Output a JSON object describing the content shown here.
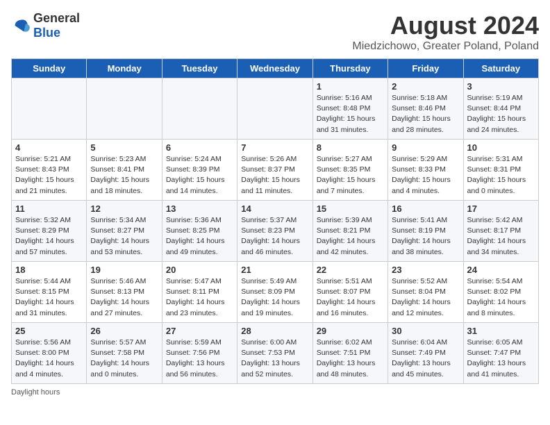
{
  "logo": {
    "general": "General",
    "blue": "Blue"
  },
  "title": "August 2024",
  "subtitle": "Miedzichowo, Greater Poland, Poland",
  "days_of_week": [
    "Sunday",
    "Monday",
    "Tuesday",
    "Wednesday",
    "Thursday",
    "Friday",
    "Saturday"
  ],
  "weeks": [
    [
      {
        "day": "",
        "info": ""
      },
      {
        "day": "",
        "info": ""
      },
      {
        "day": "",
        "info": ""
      },
      {
        "day": "",
        "info": ""
      },
      {
        "day": "1",
        "info": "Sunrise: 5:16 AM\nSunset: 8:48 PM\nDaylight: 15 hours and 31 minutes."
      },
      {
        "day": "2",
        "info": "Sunrise: 5:18 AM\nSunset: 8:46 PM\nDaylight: 15 hours and 28 minutes."
      },
      {
        "day": "3",
        "info": "Sunrise: 5:19 AM\nSunset: 8:44 PM\nDaylight: 15 hours and 24 minutes."
      }
    ],
    [
      {
        "day": "4",
        "info": "Sunrise: 5:21 AM\nSunset: 8:43 PM\nDaylight: 15 hours and 21 minutes."
      },
      {
        "day": "5",
        "info": "Sunrise: 5:23 AM\nSunset: 8:41 PM\nDaylight: 15 hours and 18 minutes."
      },
      {
        "day": "6",
        "info": "Sunrise: 5:24 AM\nSunset: 8:39 PM\nDaylight: 15 hours and 14 minutes."
      },
      {
        "day": "7",
        "info": "Sunrise: 5:26 AM\nSunset: 8:37 PM\nDaylight: 15 hours and 11 minutes."
      },
      {
        "day": "8",
        "info": "Sunrise: 5:27 AM\nSunset: 8:35 PM\nDaylight: 15 hours and 7 minutes."
      },
      {
        "day": "9",
        "info": "Sunrise: 5:29 AM\nSunset: 8:33 PM\nDaylight: 15 hours and 4 minutes."
      },
      {
        "day": "10",
        "info": "Sunrise: 5:31 AM\nSunset: 8:31 PM\nDaylight: 15 hours and 0 minutes."
      }
    ],
    [
      {
        "day": "11",
        "info": "Sunrise: 5:32 AM\nSunset: 8:29 PM\nDaylight: 14 hours and 57 minutes."
      },
      {
        "day": "12",
        "info": "Sunrise: 5:34 AM\nSunset: 8:27 PM\nDaylight: 14 hours and 53 minutes."
      },
      {
        "day": "13",
        "info": "Sunrise: 5:36 AM\nSunset: 8:25 PM\nDaylight: 14 hours and 49 minutes."
      },
      {
        "day": "14",
        "info": "Sunrise: 5:37 AM\nSunset: 8:23 PM\nDaylight: 14 hours and 46 minutes."
      },
      {
        "day": "15",
        "info": "Sunrise: 5:39 AM\nSunset: 8:21 PM\nDaylight: 14 hours and 42 minutes."
      },
      {
        "day": "16",
        "info": "Sunrise: 5:41 AM\nSunset: 8:19 PM\nDaylight: 14 hours and 38 minutes."
      },
      {
        "day": "17",
        "info": "Sunrise: 5:42 AM\nSunset: 8:17 PM\nDaylight: 14 hours and 34 minutes."
      }
    ],
    [
      {
        "day": "18",
        "info": "Sunrise: 5:44 AM\nSunset: 8:15 PM\nDaylight: 14 hours and 31 minutes."
      },
      {
        "day": "19",
        "info": "Sunrise: 5:46 AM\nSunset: 8:13 PM\nDaylight: 14 hours and 27 minutes."
      },
      {
        "day": "20",
        "info": "Sunrise: 5:47 AM\nSunset: 8:11 PM\nDaylight: 14 hours and 23 minutes."
      },
      {
        "day": "21",
        "info": "Sunrise: 5:49 AM\nSunset: 8:09 PM\nDaylight: 14 hours and 19 minutes."
      },
      {
        "day": "22",
        "info": "Sunrise: 5:51 AM\nSunset: 8:07 PM\nDaylight: 14 hours and 16 minutes."
      },
      {
        "day": "23",
        "info": "Sunrise: 5:52 AM\nSunset: 8:04 PM\nDaylight: 14 hours and 12 minutes."
      },
      {
        "day": "24",
        "info": "Sunrise: 5:54 AM\nSunset: 8:02 PM\nDaylight: 14 hours and 8 minutes."
      }
    ],
    [
      {
        "day": "25",
        "info": "Sunrise: 5:56 AM\nSunset: 8:00 PM\nDaylight: 14 hours and 4 minutes."
      },
      {
        "day": "26",
        "info": "Sunrise: 5:57 AM\nSunset: 7:58 PM\nDaylight: 14 hours and 0 minutes."
      },
      {
        "day": "27",
        "info": "Sunrise: 5:59 AM\nSunset: 7:56 PM\nDaylight: 13 hours and 56 minutes."
      },
      {
        "day": "28",
        "info": "Sunrise: 6:00 AM\nSunset: 7:53 PM\nDaylight: 13 hours and 52 minutes."
      },
      {
        "day": "29",
        "info": "Sunrise: 6:02 AM\nSunset: 7:51 PM\nDaylight: 13 hours and 48 minutes."
      },
      {
        "day": "30",
        "info": "Sunrise: 6:04 AM\nSunset: 7:49 PM\nDaylight: 13 hours and 45 minutes."
      },
      {
        "day": "31",
        "info": "Sunrise: 6:05 AM\nSunset: 7:47 PM\nDaylight: 13 hours and 41 minutes."
      }
    ]
  ],
  "footer": "Daylight hours"
}
